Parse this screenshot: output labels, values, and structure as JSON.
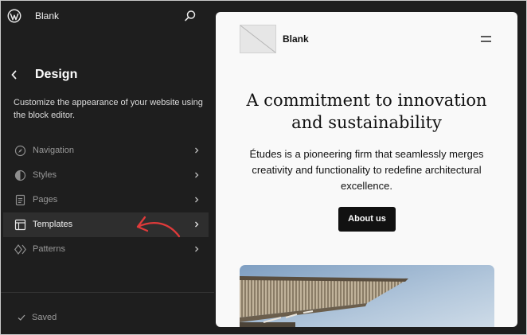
{
  "topbar": {
    "site_name": "Blank",
    "logo_icon": "wordpress-logo-icon",
    "search_icon": "search-icon"
  },
  "sidebar": {
    "title": "Design",
    "back_icon": "chevron-left-icon",
    "description": "Customize the appearance of your website using the block editor.",
    "items": [
      {
        "label": "Navigation",
        "icon": "navigation-icon",
        "active": false
      },
      {
        "label": "Styles",
        "icon": "styles-icon",
        "active": false
      },
      {
        "label": "Pages",
        "icon": "pages-icon",
        "active": false
      },
      {
        "label": "Templates",
        "icon": "templates-icon",
        "active": true
      },
      {
        "label": "Patterns",
        "icon": "patterns-icon",
        "active": false
      }
    ],
    "status": "Saved",
    "annotation_color": "#e03a3a"
  },
  "preview": {
    "site_name": "Blank",
    "heading": "A commitment to innovation and sustainability",
    "body": "Études is a pioneering firm that seamlessly merges creativity and functionality to redefine architectural excellence.",
    "cta": "About us"
  }
}
